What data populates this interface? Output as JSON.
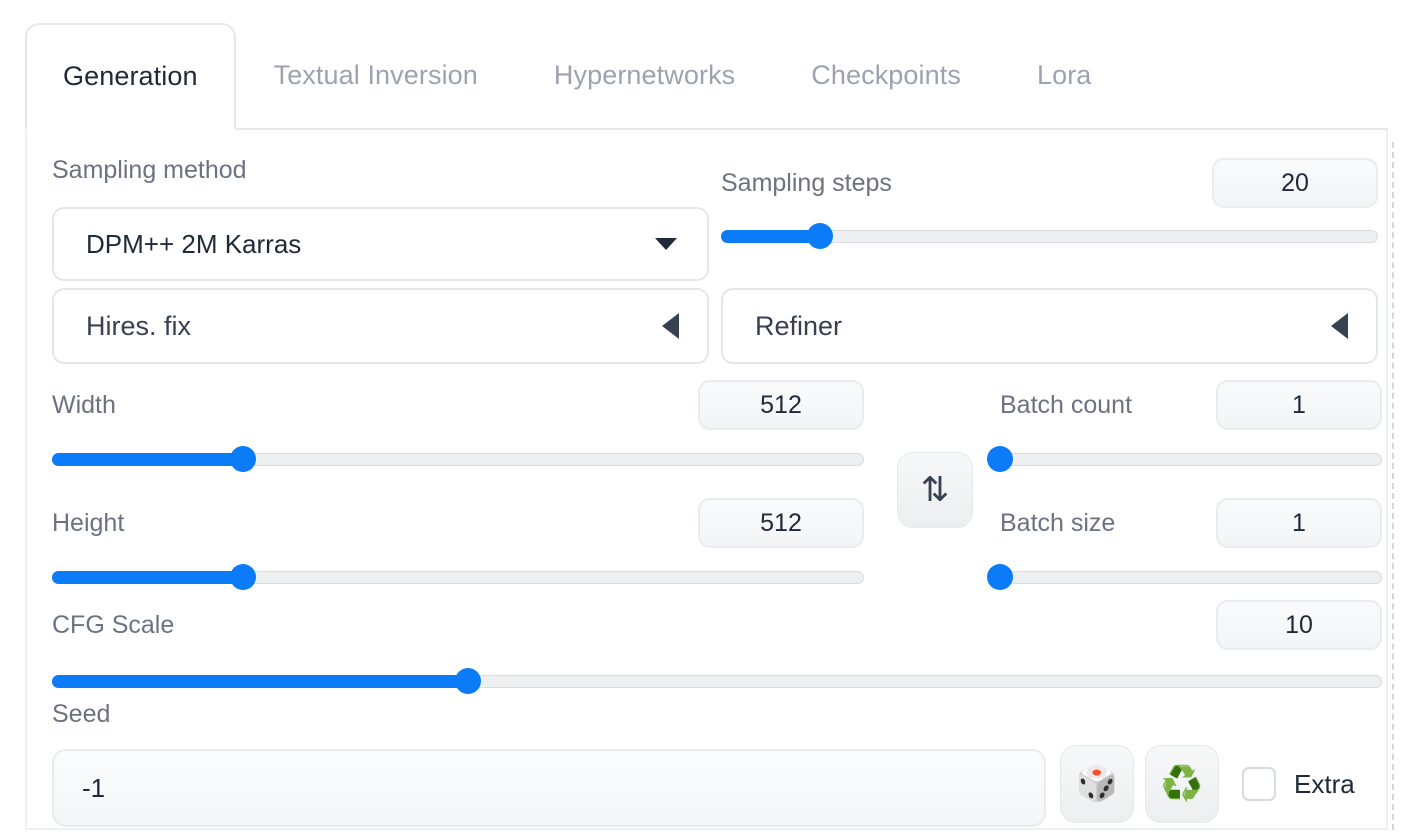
{
  "tabs": [
    {
      "label": "Generation",
      "active": true
    },
    {
      "label": "Textual Inversion",
      "active": false
    },
    {
      "label": "Hypernetworks",
      "active": false
    },
    {
      "label": "Checkpoints",
      "active": false
    },
    {
      "label": "Lora",
      "active": false
    }
  ],
  "sampling_method": {
    "label": "Sampling method",
    "value": "DPM++ 2M Karras",
    "caret_icon": "chevron-down-icon"
  },
  "sampling_steps": {
    "label": "Sampling steps",
    "value": "20",
    "slider_percent": 15
  },
  "hires_fix": {
    "label": "Hires. fix",
    "caret_icon": "triangle-left-icon",
    "expanded": false
  },
  "refiner": {
    "label": "Refiner",
    "caret_icon": "triangle-left-icon",
    "expanded": false
  },
  "width": {
    "label": "Width",
    "value": "512",
    "slider_percent": 23.5
  },
  "height": {
    "label": "Height",
    "value": "512",
    "slider_percent": 23.5
  },
  "swap_button": {
    "icon": "swap-vertical-icon",
    "glyph": "⇅"
  },
  "batch_count": {
    "label": "Batch count",
    "value": "1",
    "slider_percent": 0
  },
  "batch_size": {
    "label": "Batch size",
    "value": "1",
    "slider_percent": 0
  },
  "cfg_scale": {
    "label": "CFG Scale",
    "value": "10",
    "slider_percent": 31.3
  },
  "seed": {
    "label": "Seed",
    "value": "-1",
    "placeholder": "-1"
  },
  "seed_actions": {
    "randomize": {
      "icon": "dice-icon",
      "glyph": "🎲"
    },
    "reuse": {
      "icon": "recycle-icon",
      "glyph": "♻️"
    },
    "extra_label": "Extra",
    "extra_checked": false
  },
  "colors": {
    "accent_blue": "#0b7bf7",
    "label_gray": "#6b7280",
    "text_dark": "#1f2937",
    "tab_inactive": "#9ca3af",
    "border": "#e3e6eb"
  }
}
